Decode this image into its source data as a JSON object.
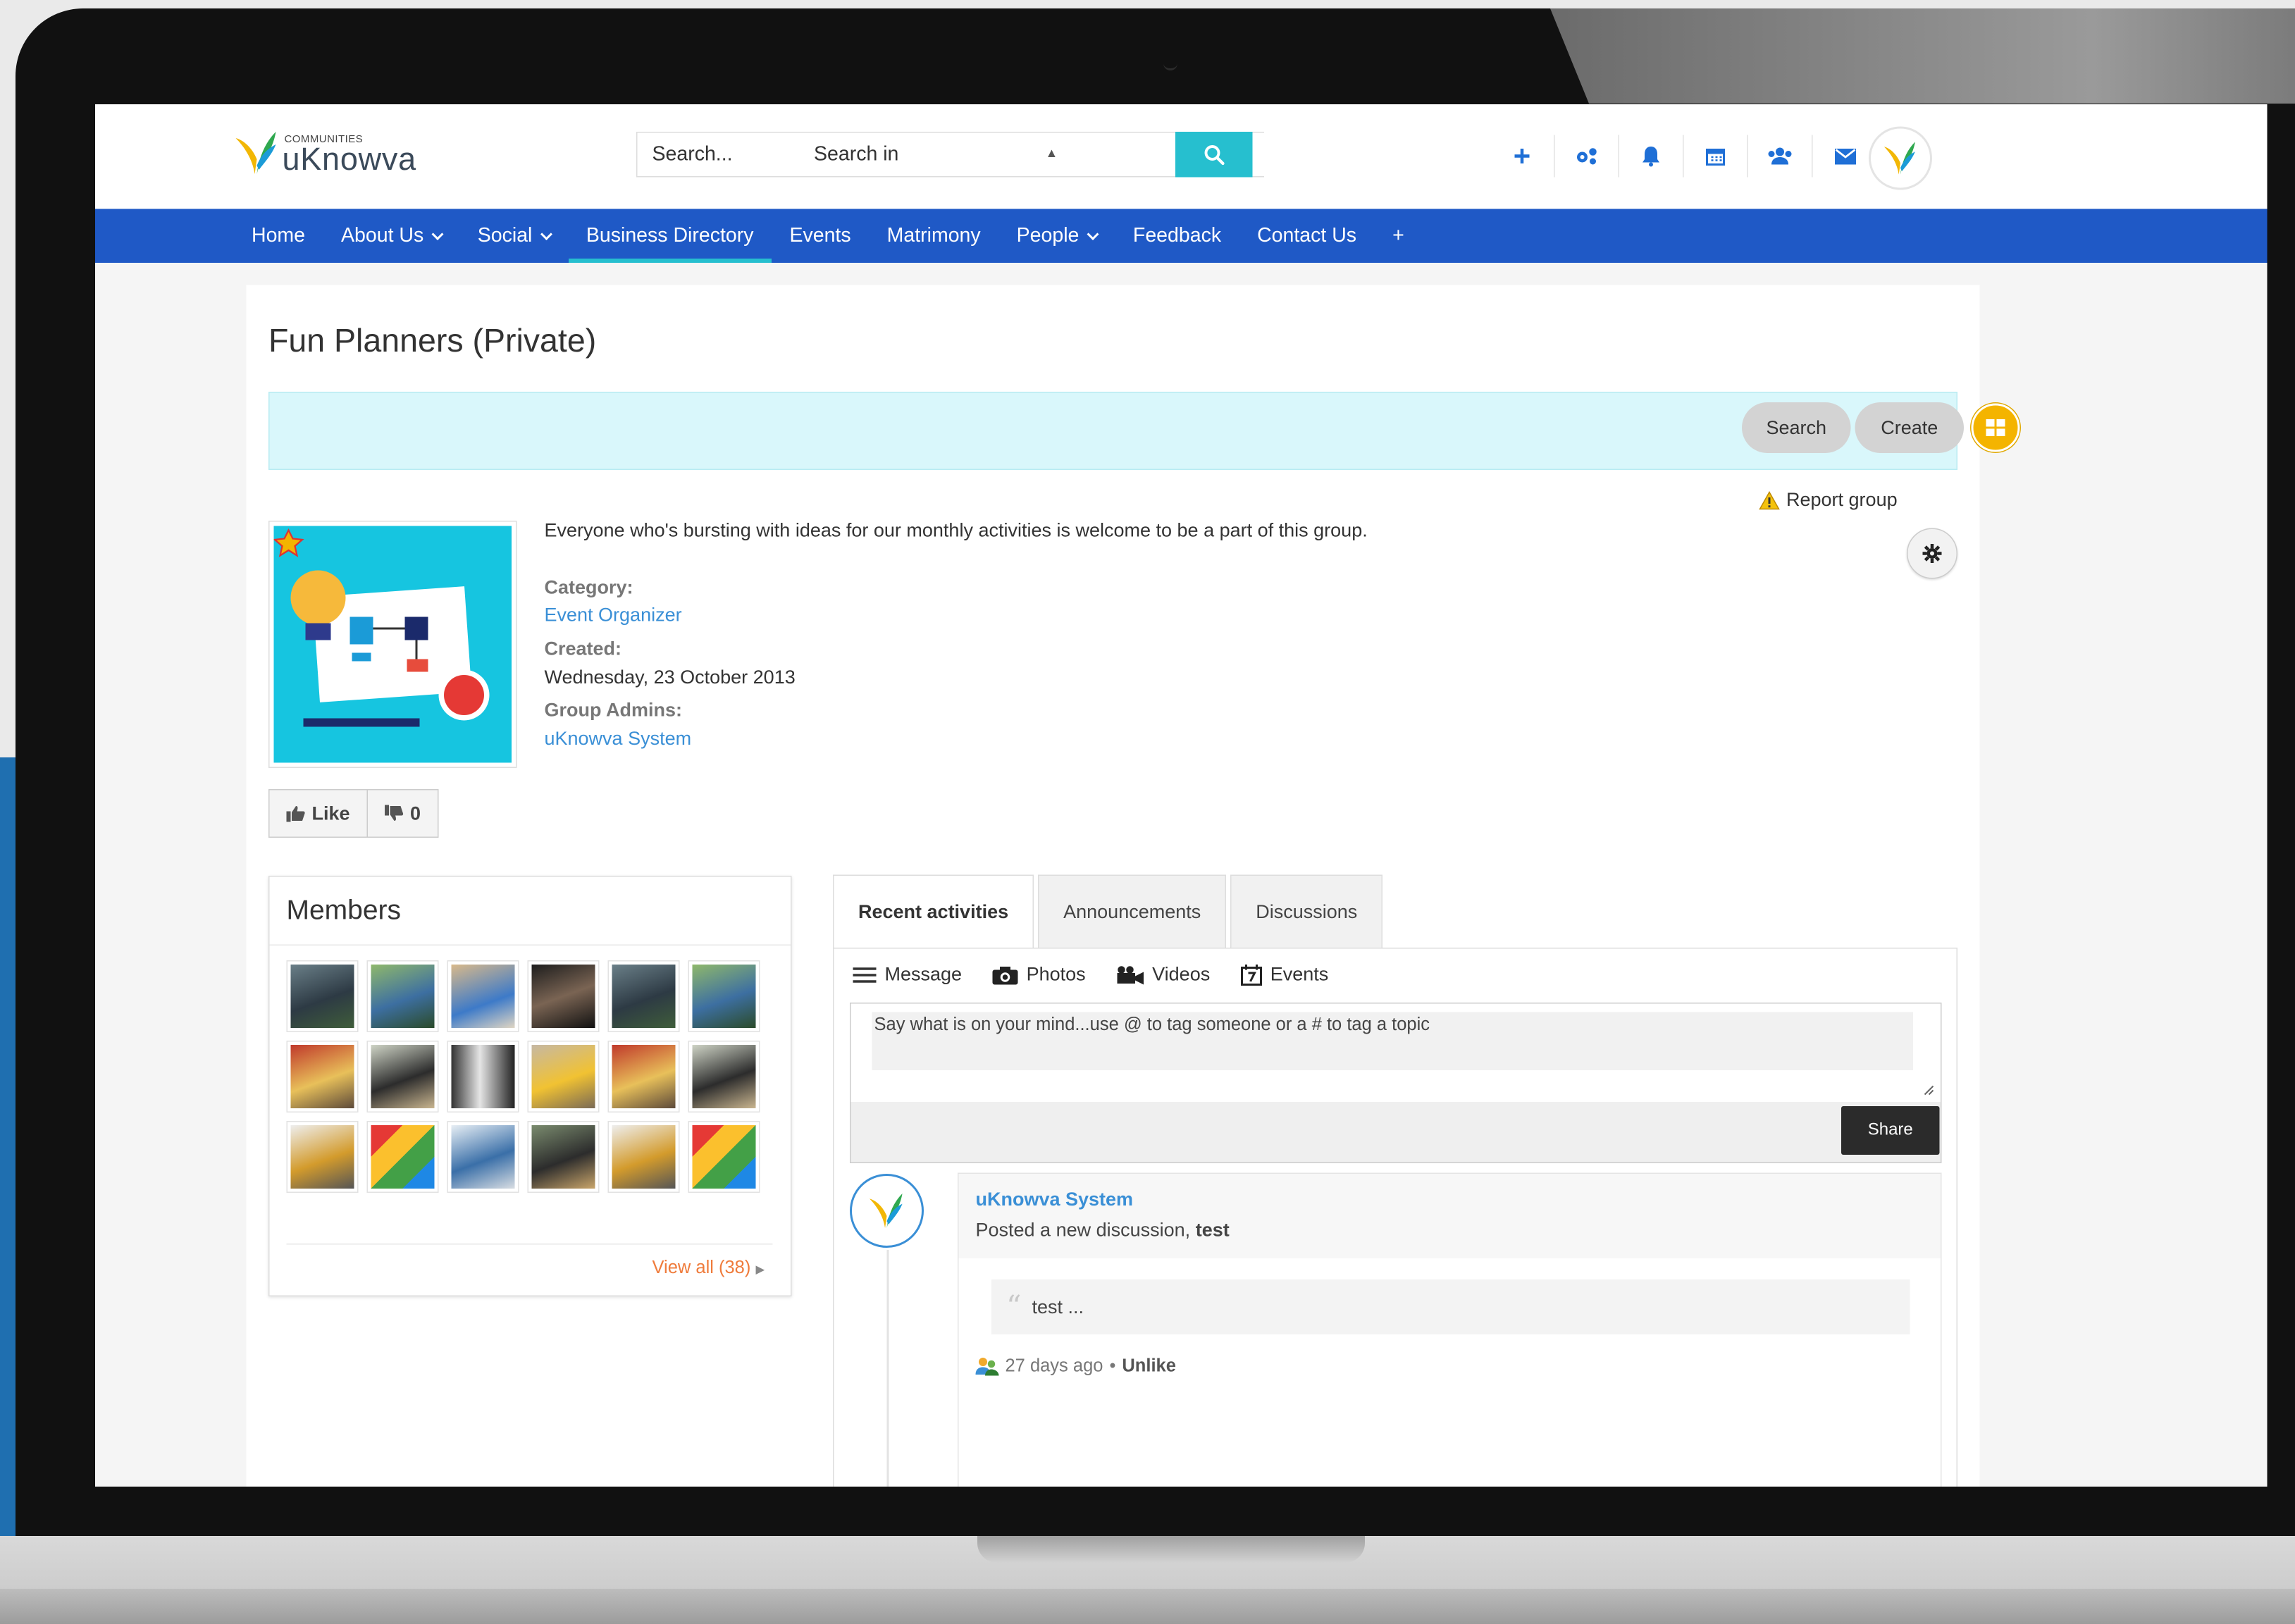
{
  "logo": {
    "sub": "COMMUNITIES",
    "name": "uKnowva"
  },
  "search": {
    "placeholder": "Search...",
    "scope_label": "Search in"
  },
  "top_icons": [
    "plus-icon",
    "share-nodes-icon",
    "bell-icon",
    "calendar-icon",
    "users-icon",
    "envelope-icon"
  ],
  "nav": {
    "items": [
      {
        "label": "Home",
        "dropdown": false,
        "active": false
      },
      {
        "label": "About Us",
        "dropdown": true,
        "active": false
      },
      {
        "label": "Social",
        "dropdown": true,
        "active": false
      },
      {
        "label": "Business Directory",
        "dropdown": false,
        "active": true
      },
      {
        "label": "Events",
        "dropdown": false,
        "active": false
      },
      {
        "label": "Matrimony",
        "dropdown": false,
        "active": false
      },
      {
        "label": "People",
        "dropdown": true,
        "active": false
      },
      {
        "label": "Feedback",
        "dropdown": false,
        "active": false
      },
      {
        "label": "Contact Us",
        "dropdown": false,
        "active": false
      },
      {
        "label": "+",
        "dropdown": false,
        "active": false
      }
    ]
  },
  "group": {
    "title": "Fun Planners (Private)",
    "description": "Everyone who's bursting with ideas for our monthly activities is welcome to be a part of this group.",
    "category_label": "Category:",
    "category": "Event Organizer",
    "created_label": "Created:",
    "created": "Wednesday, 23 October 2013",
    "admins_label": "Group Admins:",
    "admins": "uKnowva System"
  },
  "toolbar": {
    "search_label": "Search",
    "create_label": "Create"
  },
  "report_label": "Report group",
  "likes": {
    "like_label": "Like",
    "dislike_count": "0"
  },
  "members": {
    "title": "Members",
    "view_all": "View all (38)",
    "thumbs": 18
  },
  "tabs": [
    {
      "label": "Recent activities",
      "active": true
    },
    {
      "label": "Announcements",
      "active": false
    },
    {
      "label": "Discussions",
      "active": false
    }
  ],
  "composer": {
    "tabs": [
      "Message",
      "Photos",
      "Videos",
      "Events"
    ],
    "placeholder": "Say what is on your mind...use @ to tag someone or a # to tag a topic",
    "share_label": "Share"
  },
  "feed": {
    "author": "uKnowva System",
    "action": "Posted a new discussion,",
    "action_target": "test",
    "quote": "test ...",
    "time": "27 days ago",
    "unlike": "Unlike"
  },
  "colors": {
    "nav_bg": "#1f59c6",
    "accent": "#26bfcf",
    "link": "#3a8fd6",
    "view_all": "#ef7b3b"
  }
}
